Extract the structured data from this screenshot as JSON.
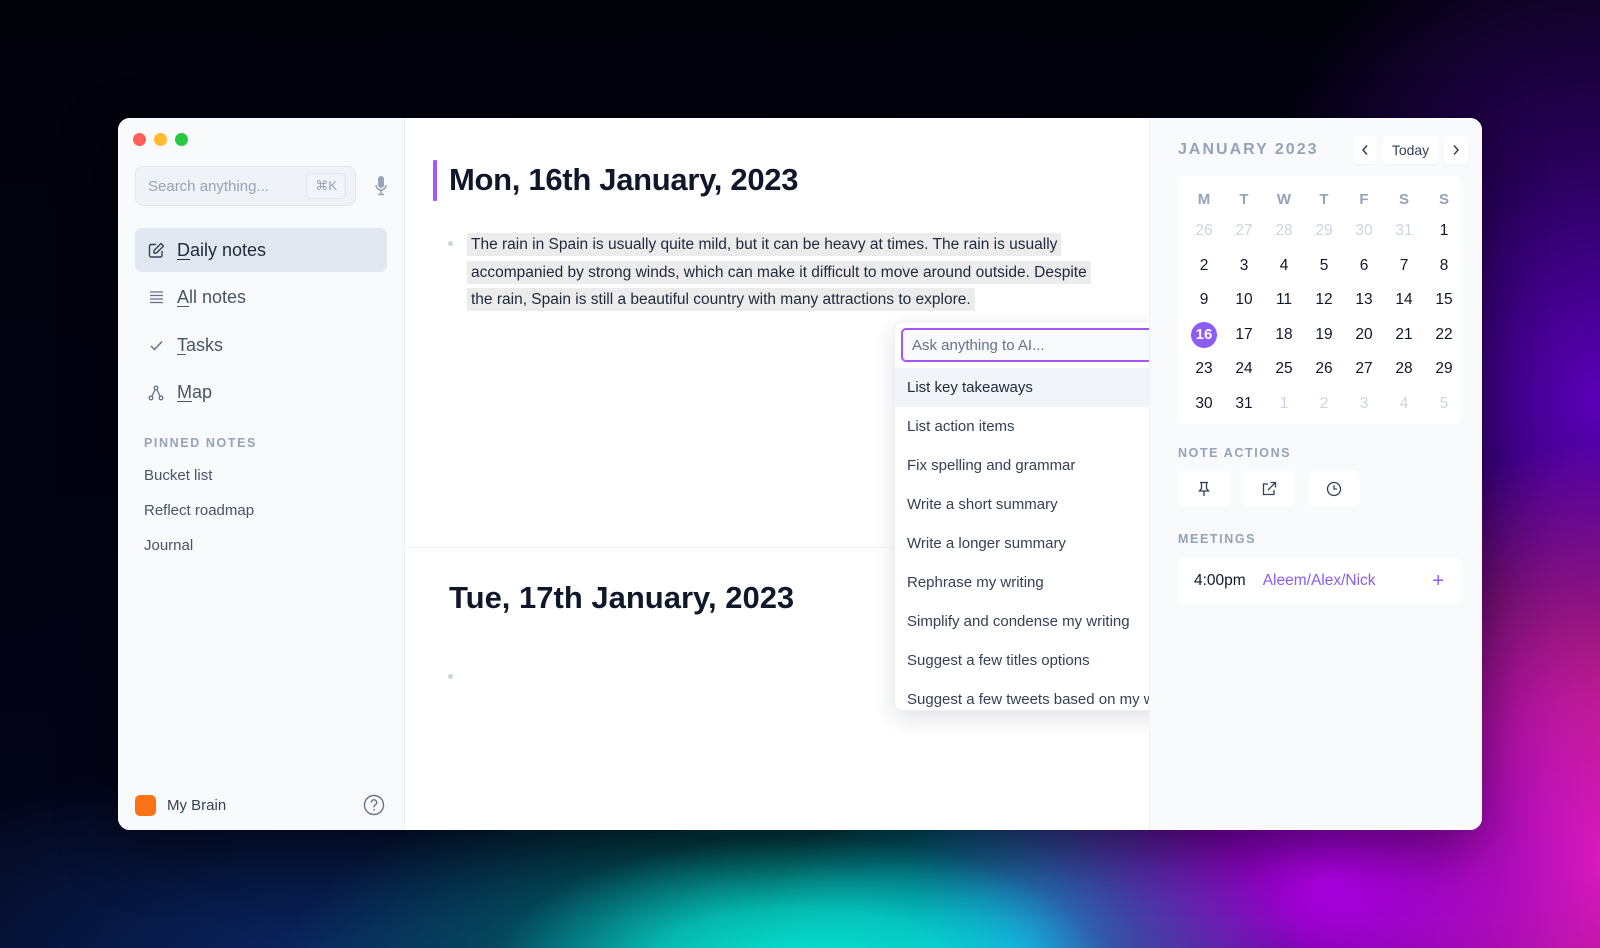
{
  "colors": {
    "accent": "#8b5cf6",
    "title_bar": "#a855f7",
    "brain": "#f97316",
    "traffic_red": "#ff5f57",
    "traffic_yellow": "#febc2e",
    "traffic_green": "#28c840"
  },
  "sidebar": {
    "search": {
      "placeholder": "Search anything...",
      "shortcut": "⌘K",
      "mic_icon": "microphone-icon"
    },
    "nav": [
      {
        "label": "Daily notes",
        "icon": "pencil-square-icon",
        "active": true
      },
      {
        "label": "All notes",
        "icon": "list-icon",
        "active": false
      },
      {
        "label": "Tasks",
        "icon": "check-icon",
        "active": false
      },
      {
        "label": "Map",
        "icon": "graph-icon",
        "active": false
      }
    ],
    "pinned_title": "PINNED NOTES",
    "pinned": [
      "Bucket list",
      "Reflect roadmap",
      "Journal"
    ],
    "footer": {
      "brain_label": "My Brain",
      "help_icon": "help-circle-icon"
    }
  },
  "main": {
    "notes": [
      {
        "title": "Mon, 16th January, 2023",
        "body": "The rain in Spain is usually quite mild, but it can be heavy at times. The rain is usually accompanied by strong winds, which can make it difficult to move around outside. Despite the rain, Spain is still a beautiful country with many attractions to explore."
      },
      {
        "title": "Tue, 17th January, 2023",
        "body": ""
      }
    ],
    "ai_popup": {
      "placeholder": "Ask anything to AI...",
      "value": "",
      "items": [
        "List key takeaways",
        "List action items",
        "Fix spelling and grammar",
        "Write a short summary",
        "Write a longer summary",
        "Rephrase my writing",
        "Simplify and condense my writing",
        "Suggest a few titles options",
        "Suggest a few tweets based on my writing"
      ],
      "highlighted_index": 0
    }
  },
  "right_panel": {
    "calendar": {
      "month_label": "JANUARY 2023",
      "prev_label": "‹",
      "today_label": "Today",
      "next_label": "›",
      "weekdays": [
        "M",
        "T",
        "W",
        "T",
        "F",
        "S",
        "S"
      ],
      "weeks": [
        [
          {
            "d": "26",
            "m": true
          },
          {
            "d": "27",
            "m": true
          },
          {
            "d": "28",
            "m": true
          },
          {
            "d": "29",
            "m": true
          },
          {
            "d": "30",
            "m": true
          },
          {
            "d": "31",
            "m": true
          },
          {
            "d": "1"
          }
        ],
        [
          {
            "d": "2"
          },
          {
            "d": "3"
          },
          {
            "d": "4"
          },
          {
            "d": "5"
          },
          {
            "d": "6"
          },
          {
            "d": "7"
          },
          {
            "d": "8"
          }
        ],
        [
          {
            "d": "9"
          },
          {
            "d": "10"
          },
          {
            "d": "11"
          },
          {
            "d": "12"
          },
          {
            "d": "13"
          },
          {
            "d": "14"
          },
          {
            "d": "15"
          }
        ],
        [
          {
            "d": "16",
            "t": true
          },
          {
            "d": "17"
          },
          {
            "d": "18"
          },
          {
            "d": "19"
          },
          {
            "d": "20"
          },
          {
            "d": "21"
          },
          {
            "d": "22"
          }
        ],
        [
          {
            "d": "23"
          },
          {
            "d": "24"
          },
          {
            "d": "25"
          },
          {
            "d": "26"
          },
          {
            "d": "27"
          },
          {
            "d": "28"
          },
          {
            "d": "29"
          }
        ],
        [
          {
            "d": "30"
          },
          {
            "d": "31"
          },
          {
            "d": "1",
            "m": true
          },
          {
            "d": "2",
            "m": true
          },
          {
            "d": "3",
            "m": true
          },
          {
            "d": "4",
            "m": true
          },
          {
            "d": "5",
            "m": true
          }
        ]
      ],
      "selected_day": "16"
    },
    "note_actions_title": "NOTE ACTIONS",
    "note_actions": [
      "pin-icon",
      "external-link-icon",
      "clock-icon"
    ],
    "meetings_title": "MEETINGS",
    "meetings": [
      {
        "time": "4:00pm",
        "attendees": "Aleem/Alex/Nick",
        "add_label": "+"
      }
    ]
  }
}
